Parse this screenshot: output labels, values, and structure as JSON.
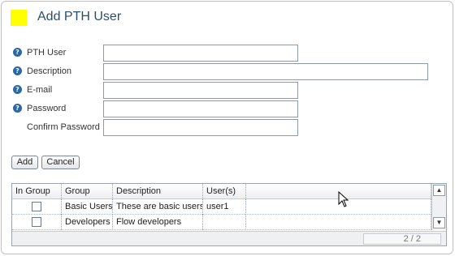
{
  "page": {
    "title": "Add PTH User",
    "title_icon_color": "#ffff00"
  },
  "form": {
    "fields": [
      {
        "label": "PTH User",
        "value": "",
        "has_help": true
      },
      {
        "label": "Description",
        "value": "",
        "has_help": true
      },
      {
        "label": "E-mail",
        "value": "",
        "has_help": true
      },
      {
        "label": "Password",
        "value": "",
        "has_help": true
      },
      {
        "label": "Confirm Password",
        "value": "",
        "has_help": false
      }
    ],
    "help_icon_glyph": "?"
  },
  "buttons": {
    "add": "Add",
    "cancel": "Cancel"
  },
  "grid": {
    "columns": [
      "In Group",
      "Group",
      "Description",
      "User(s)"
    ],
    "rows": [
      {
        "in_group": false,
        "group": "Basic Users",
        "description": "These are basic users",
        "users": "user1"
      },
      {
        "in_group": false,
        "group": "Developers",
        "description": "Flow developers",
        "users": ""
      }
    ],
    "pager": "2 / 2",
    "scroll_up_glyph": "▲",
    "scroll_down_glyph": "▼"
  }
}
